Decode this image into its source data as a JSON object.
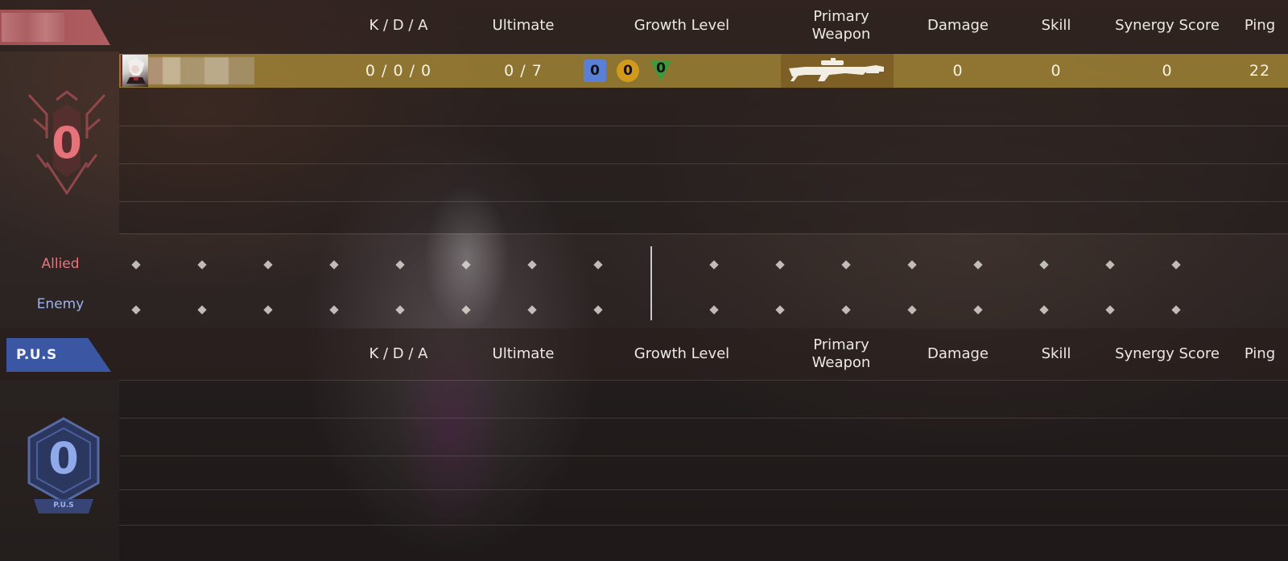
{
  "header_columns": {
    "kda": "K / D / A",
    "ultimate": "Ultimate",
    "growth_level": "Growth Level",
    "primary_weapon": "Primary\nWeapon",
    "damage": "Damage",
    "skill": "Skill",
    "synergy_score": "Synergy Score",
    "ping": "Ping"
  },
  "allied_team": {
    "score": "0",
    "accent_color": "#e6727a",
    "players": [
      {
        "kda": "0 / 0 / 0",
        "ultimate": "0 / 7",
        "growth": [
          "0",
          "0",
          "0"
        ],
        "weapon_icon": "sniper-rifle-icon",
        "damage": "0",
        "skill": "0",
        "synergy_score": "0",
        "ping": "22"
      }
    ]
  },
  "lanes": {
    "allied_label": "Allied",
    "enemy_label": "Enemy",
    "allied_color": "#e8767c",
    "enemy_color": "#9fb3ea"
  },
  "enemy_team": {
    "tag": "P.U.S",
    "score": "0",
    "emblem_label": "P.U.S",
    "accent_color": "#8fa9ea"
  },
  "growth_colors": [
    "#5a7fd6",
    "#d29a1c",
    "#3c9a3c"
  ]
}
